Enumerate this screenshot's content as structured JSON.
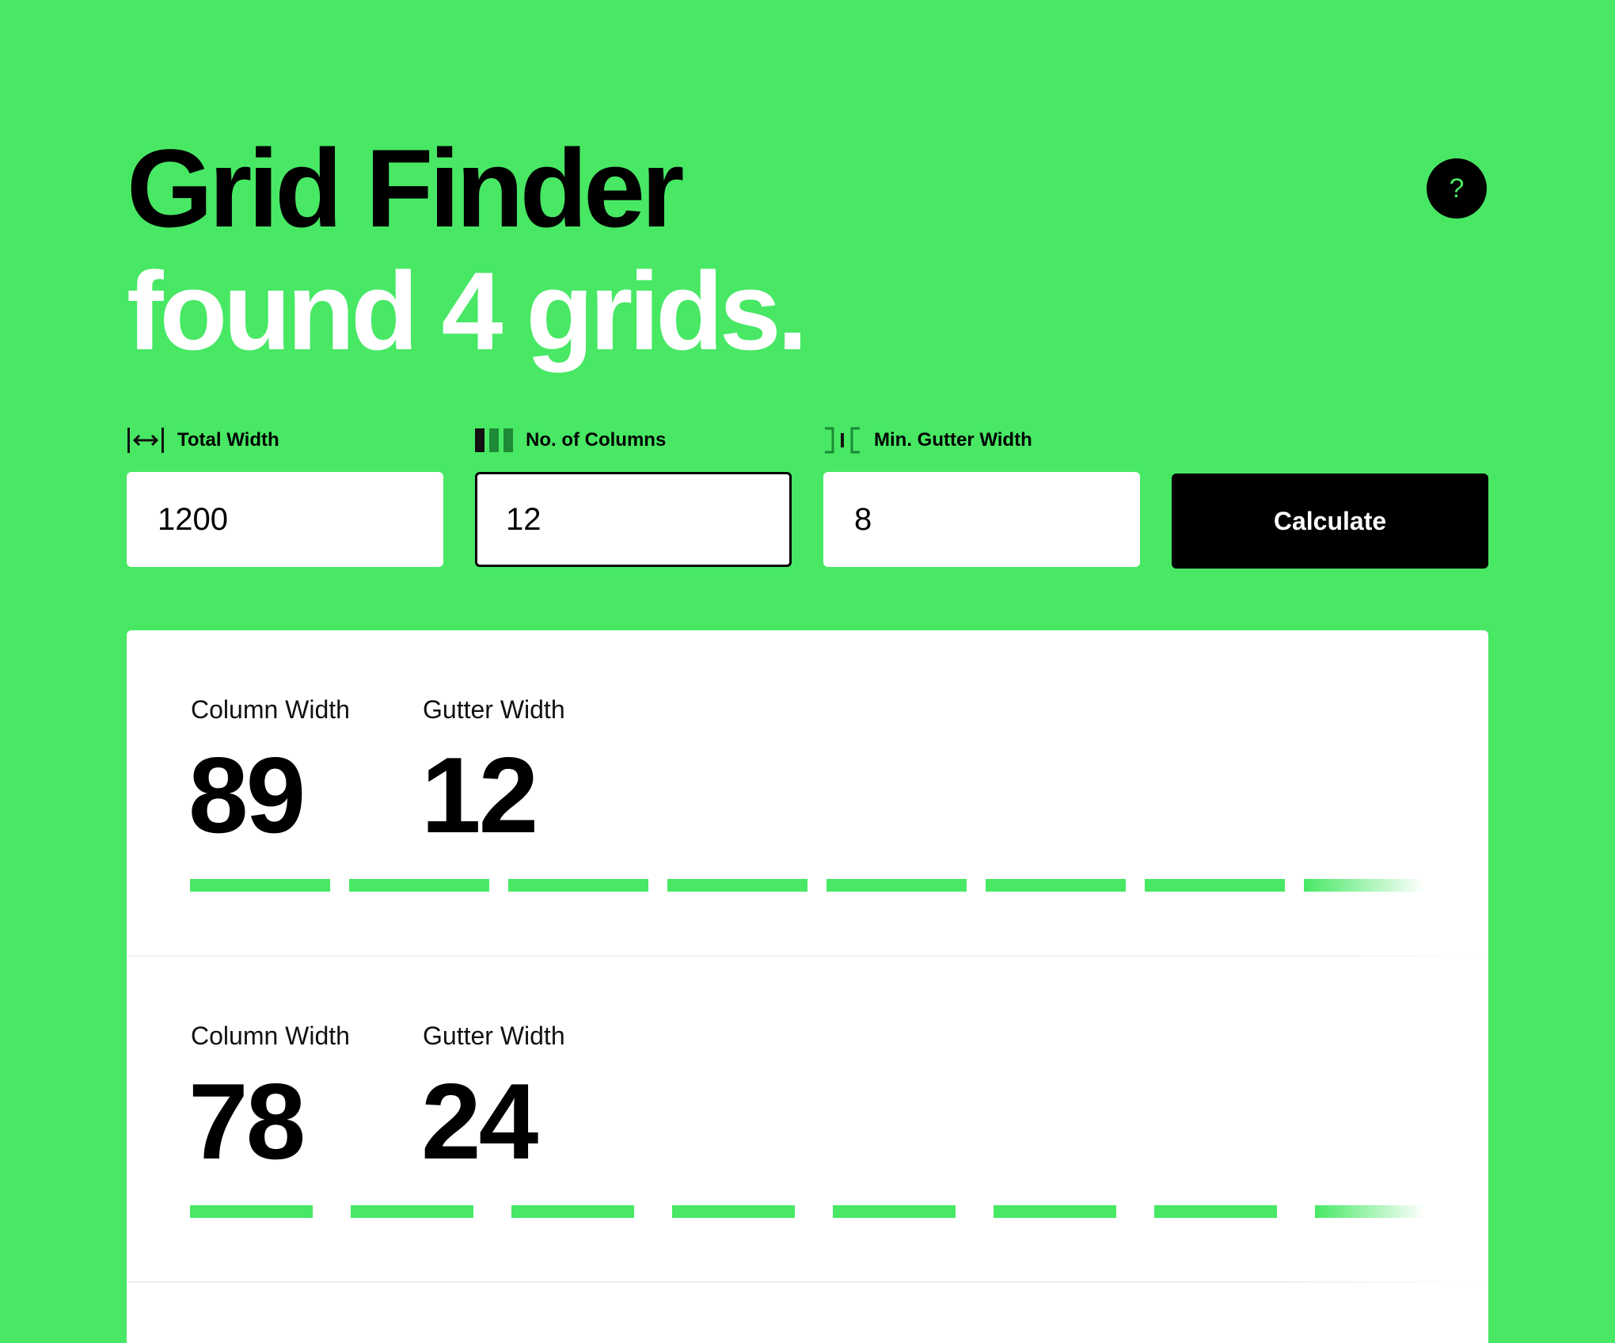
{
  "header": {
    "title": "Grid Finder",
    "subtitle": "found 4 grids.",
    "help_label": "?"
  },
  "form": {
    "total_width": {
      "label": "Total Width",
      "value": "1200",
      "icon": "total-width-icon"
    },
    "columns": {
      "label": "No. of Columns",
      "value": "12",
      "icon": "columns-icon"
    },
    "gutter": {
      "label": "Min. Gutter Width",
      "value": "8",
      "icon": "gutter-icon"
    },
    "calculate_label": "Calculate"
  },
  "results": [
    {
      "column_label": "Column Width",
      "column_width": "89",
      "gutter_label": "Gutter Width",
      "gutter_width": "12"
    },
    {
      "column_label": "Column Width",
      "column_width": "78",
      "gutter_label": "Gutter Width",
      "gutter_width": "24"
    }
  ],
  "colors": {
    "accent": "#48e865",
    "background": "#48e865",
    "button": "#000000",
    "panel": "#ffffff"
  }
}
